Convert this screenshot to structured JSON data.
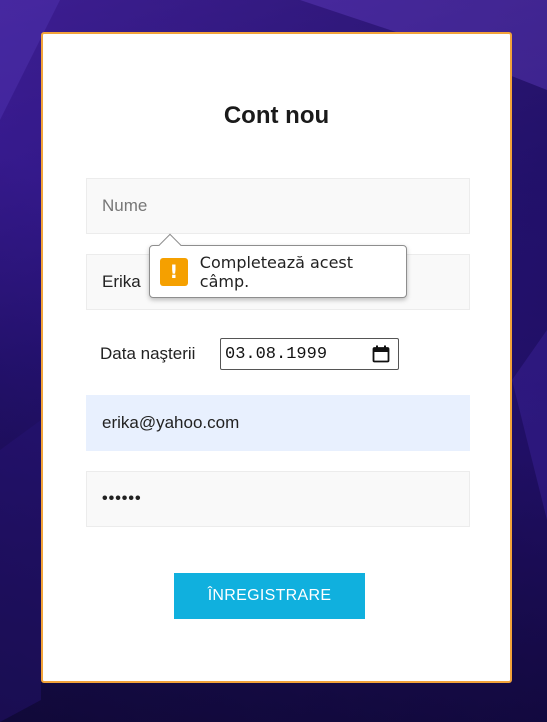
{
  "form": {
    "title": "Cont nou",
    "name_placeholder": "Nume",
    "surname_value": "Erika",
    "dob_label": "Data naşterii",
    "dob_value": "03.08.1999",
    "email_value": "erika@yahoo.com",
    "password_value": "••••••",
    "submit_label": "ÎNREGISTRARE"
  },
  "validation": {
    "message": "Completează acest câmp.",
    "icon": "warning-icon",
    "icon_glyph": "!"
  },
  "colors": {
    "card_border": "#f2a33a",
    "button_bg": "#10b0de",
    "warning": "#f5a000",
    "autofill_bg": "#e8f0fe"
  }
}
